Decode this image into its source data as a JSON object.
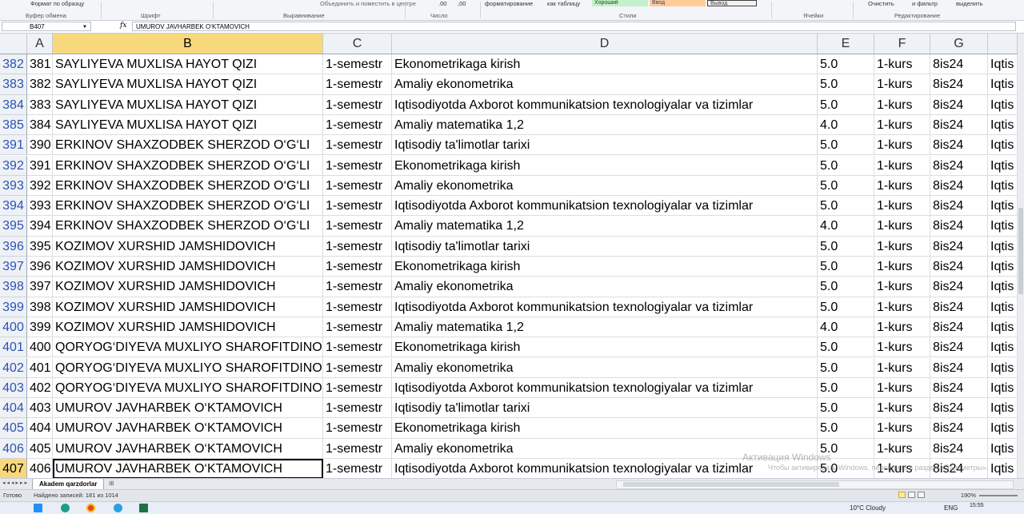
{
  "ribbon": {
    "top_items": [
      "Формат по образцу",
      "форматирование",
      "как таблицу",
      "Хороший",
      "Ввод",
      "Вывод",
      "Очистить",
      "и фильтр",
      "выделить"
    ],
    "groups": [
      "Буфер обмена",
      "Шрифт",
      "Выравнивание",
      "Число",
      "Стили",
      "Ячейки",
      "Редактирование"
    ],
    "merge_label": "Объединить и поместить в центре",
    "number_formats": [
      ".00",
      ",00"
    ]
  },
  "formula_bar": {
    "name_box": "B407",
    "fx": "fx",
    "content": "UMUROV JAVHARBEK O‘KTAMOVICH"
  },
  "columns": [
    "A",
    "B",
    "C",
    "D",
    "E",
    "F",
    "G"
  ],
  "selected_column": "B",
  "rows": [
    {
      "rn": "382",
      "a": "381",
      "b": "SAYLIYEVA MUXLISA HAYOT QIZI",
      "c": "1-semestr",
      "d": "Ekonometrikaga kirish",
      "e": "5.0",
      "f": "1-kurs",
      "g": "8is24",
      "h": "Iqtis"
    },
    {
      "rn": "383",
      "a": "382",
      "b": "SAYLIYEVA MUXLISA HAYOT QIZI",
      "c": "1-semestr",
      "d": "Amaliy ekonometrika",
      "e": "5.0",
      "f": "1-kurs",
      "g": "8is24",
      "h": "Iqtis"
    },
    {
      "rn": "384",
      "a": "383",
      "b": "SAYLIYEVA MUXLISA HAYOT QIZI",
      "c": "1-semestr",
      "d": "Iqtisodiyotda Axborot kommunikatsion texnologiyalar va tizimlar",
      "e": "5.0",
      "f": "1-kurs",
      "g": "8is24",
      "h": "Iqtis"
    },
    {
      "rn": "385",
      "a": "384",
      "b": "SAYLIYEVA MUXLISA HAYOT QIZI",
      "c": "1-semestr",
      "d": "Amaliy matematika 1,2",
      "e": "4.0",
      "f": "1-kurs",
      "g": "8is24",
      "h": "Iqtis"
    },
    {
      "rn": "391",
      "a": "390",
      "b": "ERKINOV SHAXZODBEK SHERZOD O‘G‘LI",
      "c": "1-semestr",
      "d": "Iqtisodiy ta'limotlar tarixi",
      "e": "5.0",
      "f": "1-kurs",
      "g": "8is24",
      "h": "Iqtis"
    },
    {
      "rn": "392",
      "a": "391",
      "b": "ERKINOV SHAXZODBEK SHERZOD O‘G‘LI",
      "c": "1-semestr",
      "d": "Ekonometrikaga kirish",
      "e": "5.0",
      "f": "1-kurs",
      "g": "8is24",
      "h": "Iqtis"
    },
    {
      "rn": "393",
      "a": "392",
      "b": "ERKINOV SHAXZODBEK SHERZOD O‘G‘LI",
      "c": "1-semestr",
      "d": "Amaliy ekonometrika",
      "e": "5.0",
      "f": "1-kurs",
      "g": "8is24",
      "h": "Iqtis"
    },
    {
      "rn": "394",
      "a": "393",
      "b": "ERKINOV SHAXZODBEK SHERZOD O‘G‘LI",
      "c": "1-semestr",
      "d": "Iqtisodiyotda Axborot kommunikatsion texnologiyalar va tizimlar",
      "e": "5.0",
      "f": "1-kurs",
      "g": "8is24",
      "h": "Iqtis"
    },
    {
      "rn": "395",
      "a": "394",
      "b": "ERKINOV SHAXZODBEK SHERZOD O‘G‘LI",
      "c": "1-semestr",
      "d": "Amaliy matematika 1,2",
      "e": "4.0",
      "f": "1-kurs",
      "g": "8is24",
      "h": "Iqtis"
    },
    {
      "rn": "396",
      "a": "395",
      "b": "KOZIMOV XURSHID JAMSHIDOVICH",
      "c": "1-semestr",
      "d": "Iqtisodiy ta'limotlar tarixi",
      "e": "5.0",
      "f": "1-kurs",
      "g": "8is24",
      "h": "Iqtis"
    },
    {
      "rn": "397",
      "a": "396",
      "b": "KOZIMOV XURSHID JAMSHIDOVICH",
      "c": "1-semestr",
      "d": "Ekonometrikaga kirish",
      "e": "5.0",
      "f": "1-kurs",
      "g": "8is24",
      "h": "Iqtis"
    },
    {
      "rn": "398",
      "a": "397",
      "b": "KOZIMOV XURSHID JAMSHIDOVICH",
      "c": "1-semestr",
      "d": "Amaliy ekonometrika",
      "e": "5.0",
      "f": "1-kurs",
      "g": "8is24",
      "h": "Iqtis"
    },
    {
      "rn": "399",
      "a": "398",
      "b": "KOZIMOV XURSHID JAMSHIDOVICH",
      "c": "1-semestr",
      "d": "Iqtisodiyotda Axborot kommunikatsion texnologiyalar va tizimlar",
      "e": "5.0",
      "f": "1-kurs",
      "g": "8is24",
      "h": "Iqtis"
    },
    {
      "rn": "400",
      "a": "399",
      "b": "KOZIMOV XURSHID JAMSHIDOVICH",
      "c": "1-semestr",
      "d": "Amaliy matematika 1,2",
      "e": "4.0",
      "f": "1-kurs",
      "g": "8is24",
      "h": "Iqtis"
    },
    {
      "rn": "401",
      "a": "400",
      "b": "QORYOG‘DIYEVA MUXLIYO SHAROFITDINOVNA",
      "c": "1-semestr",
      "d": "Ekonometrikaga kirish",
      "e": "5.0",
      "f": "1-kurs",
      "g": "8is24",
      "h": "Iqtis"
    },
    {
      "rn": "402",
      "a": "401",
      "b": "QORYOG‘DIYEVA MUXLIYO SHAROFITDINOVNA",
      "c": "1-semestr",
      "d": "Amaliy ekonometrika",
      "e": "5.0",
      "f": "1-kurs",
      "g": "8is24",
      "h": "Iqtis"
    },
    {
      "rn": "403",
      "a": "402",
      "b": "QORYOG‘DIYEVA MUXLIYO SHAROFITDINOVNA",
      "c": "1-semestr",
      "d": "Iqtisodiyotda Axborot kommunikatsion texnologiyalar va tizimlar",
      "e": "5.0",
      "f": "1-kurs",
      "g": "8is24",
      "h": "Iqtis"
    },
    {
      "rn": "404",
      "a": "403",
      "b": "UMUROV JAVHARBEK O‘KTAMOVICH",
      "c": "1-semestr",
      "d": "Iqtisodiy ta'limotlar tarixi",
      "e": "5.0",
      "f": "1-kurs",
      "g": "8is24",
      "h": "Iqtis"
    },
    {
      "rn": "405",
      "a": "404",
      "b": "UMUROV JAVHARBEK O‘KTAMOVICH",
      "c": "1-semestr",
      "d": "Ekonometrikaga kirish",
      "e": "5.0",
      "f": "1-kurs",
      "g": "8is24",
      "h": "Iqtis"
    },
    {
      "rn": "406",
      "a": "405",
      "b": "UMUROV JAVHARBEK O‘KTAMOVICH",
      "c": "1-semestr",
      "d": "Amaliy ekonometrika",
      "e": "5.0",
      "f": "1-kurs",
      "g": "8is24",
      "h": "Iqtis"
    },
    {
      "rn": "407",
      "a": "406",
      "b": "UMUROV JAVHARBEK O‘KTAMOVICH",
      "c": "1-semestr",
      "d": "Iqtisodiyotda Axborot kommunikatsion texnologiyalar va tizimlar",
      "e": "5.0",
      "f": "1-kurs",
      "g": "8is24",
      "h": "Iqtis"
    }
  ],
  "active_row": "407",
  "sheet_tab": "Akadem qarzdorlar",
  "status": {
    "ready": "Готово",
    "found": "Найдено записей: 181 из 1014",
    "zoom": "190%"
  },
  "watermark": {
    "title": "Активация Windows",
    "subtitle": "Чтобы активировать Windows, перейдите в раздел «Параметры»."
  },
  "taskbar": {
    "weather": "10°C  Cloudy",
    "lang": "ENG",
    "time": "15:55"
  },
  "accent_color": "#f8d87c",
  "row_header_color": "#2b52b6"
}
